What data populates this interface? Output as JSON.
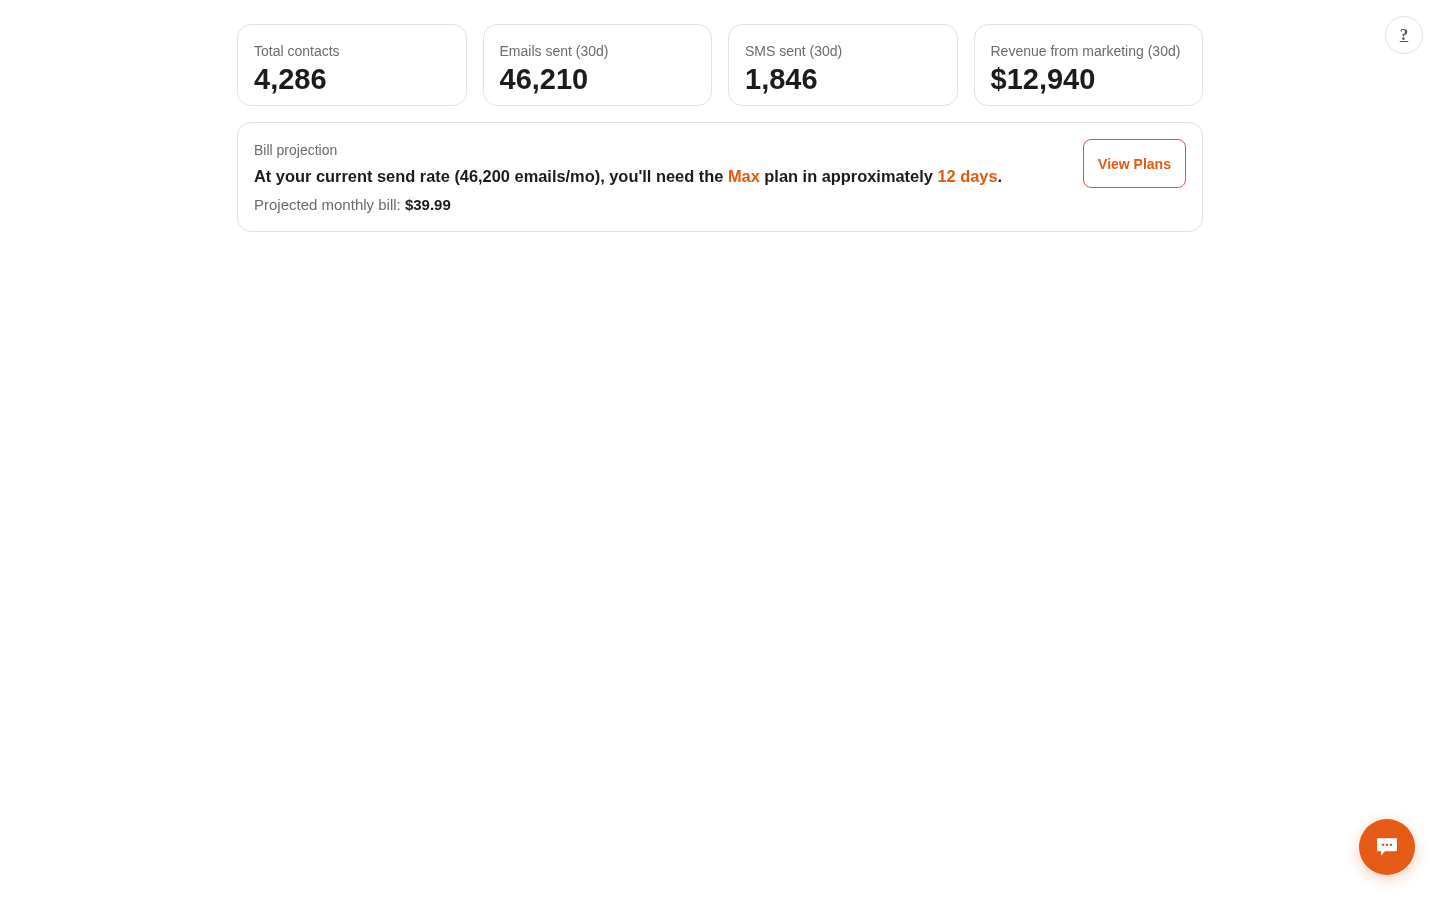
{
  "stats": [
    {
      "label": "Total contacts",
      "value": "4,286"
    },
    {
      "label": "Emails sent (30d)",
      "value": "46,210"
    },
    {
      "label": "SMS sent (30d)",
      "value": "1,846"
    },
    {
      "label": "Revenue from marketing (30d)",
      "value": "$12,940"
    }
  ],
  "bill_projection": {
    "title": "Bill projection",
    "message": [
      {
        "text": "At your current send rate (46,200 emails/mo), you'll need the ",
        "highlight": false
      },
      {
        "text": "Max",
        "highlight": true
      },
      {
        "text": " plan in approximately ",
        "highlight": false
      },
      {
        "text": "12 days",
        "highlight": true
      },
      {
        "text": ".",
        "highlight": false
      }
    ],
    "projected_bill": "Projected monthly bill: **$39.99**",
    "button": "View Plans"
  },
  "help_button": {
    "label": "?"
  }
}
